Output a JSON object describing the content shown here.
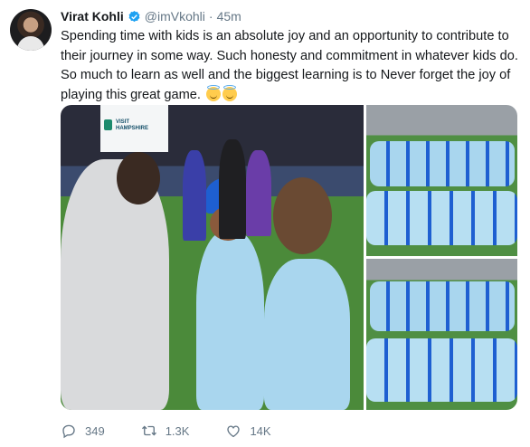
{
  "tweet": {
    "author_name": "Virat Kohli",
    "handle": "@imVkohli",
    "separator": "·",
    "time": "45m",
    "text": "Spending time with kids is an absolute joy and an opportunity to contribute to their journey in some way. Such honesty and commitment in whatever kids do. So much to learn as well and the biggest  learning is to Never forget the joy of playing this great game.",
    "media": {
      "banner_text": "VISIT\nHAMPSHIRE"
    },
    "actions": {
      "replies": "349",
      "retweets": "1.3K",
      "likes": "14K"
    }
  },
  "colors": {
    "accent": "#1da1f2",
    "secondary_text": "#657786",
    "primary_text": "#14171a"
  },
  "icons": [
    "verified-badge-icon",
    "smiling-face-with-halo-emoji",
    "reply-icon",
    "retweet-icon",
    "like-icon"
  ]
}
